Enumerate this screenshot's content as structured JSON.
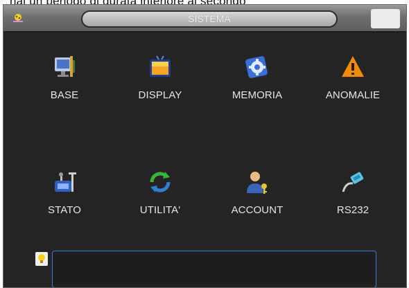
{
  "background_text": "hai un periodo di durata inferiore al secondo",
  "window": {
    "title": "SISTEMA"
  },
  "menu": [
    {
      "label": "BASE",
      "icon": "monitor-tools-icon"
    },
    {
      "label": "DISPLAY",
      "icon": "tv-icon"
    },
    {
      "label": "MEMORIA",
      "icon": "gear-disk-icon"
    },
    {
      "label": "ANOMALIE",
      "icon": "warning-icon"
    },
    {
      "label": "STATO",
      "icon": "status-tools-icon"
    },
    {
      "label": "UTILITA'",
      "icon": "refresh-icon"
    },
    {
      "label": "ACCOUNT",
      "icon": "user-key-icon"
    },
    {
      "label": "RS232",
      "icon": "serial-cable-icon"
    }
  ],
  "tip": {
    "icon": "lightbulb-icon",
    "text": ""
  },
  "colors": {
    "window_bg": "#242424",
    "title_bar": "#6f6f6f",
    "label_text": "#e6e6e6",
    "tip_border": "#3a7fc8",
    "warning": "#f28c00"
  }
}
